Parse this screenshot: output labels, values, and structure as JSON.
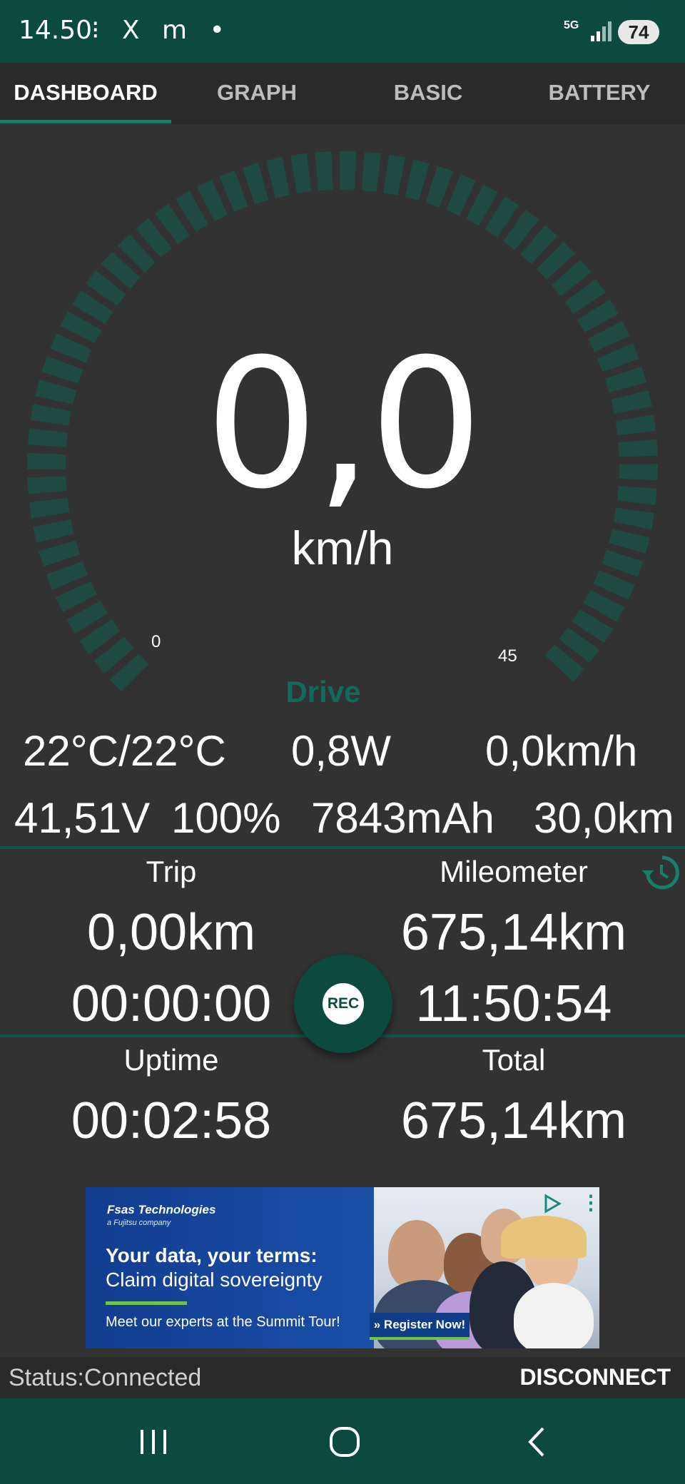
{
  "status_bar": {
    "time": "14.50",
    "notifications": "•",
    "network": "5G",
    "battery": "74"
  },
  "tabs": [
    {
      "label": "DASHBOARD",
      "active": true
    },
    {
      "label": "GRAPH",
      "active": false
    },
    {
      "label": "BASIC",
      "active": false
    },
    {
      "label": "BATTERY",
      "active": false
    }
  ],
  "gauge": {
    "speed": "0,0",
    "unit": "km/h",
    "min_label": "0",
    "max_label": "45",
    "mode": "Drive",
    "value_fraction": 0
  },
  "stats_row1": {
    "temperature": "22°C/22°C",
    "power": "0,8W",
    "speed2": "0,0km/h"
  },
  "stats_row2": {
    "voltage": "41,51V",
    "percent": "100%",
    "capacity": "7843mAh",
    "range": "30,0km"
  },
  "trip": {
    "label": "Trip",
    "distance": "0,00km",
    "time": "00:00:00"
  },
  "mileometer": {
    "label": "Mileometer",
    "distance": "675,14km",
    "time": "11:50:54"
  },
  "rec_label": "REC",
  "uptime": {
    "label": "Uptime",
    "value": "00:02:58"
  },
  "total": {
    "label": "Total",
    "value": "675,14km"
  },
  "ad": {
    "brand": "Fsas Technologies",
    "brand_sub": "a Fujitsu company",
    "headline": "Your data, your terms:",
    "subline": "Claim digital sovereignty",
    "cta_text": "Meet our experts at the Summit Tour!",
    "button": "» Register Now!"
  },
  "bottom": {
    "status": "Status:Connected",
    "disconnect": "DISCONNECT"
  },
  "colors": {
    "accent": "#0d4a3e",
    "gauge_track": "#1f4a42",
    "mode_text": "#106b5c",
    "background": "#323232"
  }
}
